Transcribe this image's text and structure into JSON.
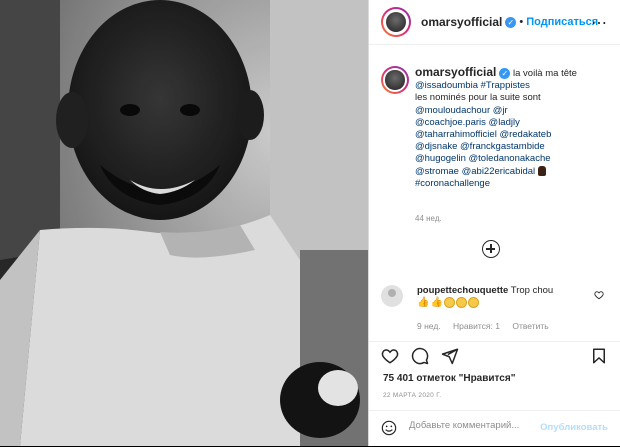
{
  "header": {
    "username": "omarsyofficial",
    "separator": "•",
    "follow_label": "Подписаться",
    "more_icon": "⋯"
  },
  "caption": {
    "username": "omarsyofficial",
    "line1": "la voilà ma tête",
    "line2_a": "@issadoumbia",
    "line2_b": "#Trappistes",
    "line3": "les nominés pour la suite sont",
    "tags": [
      "@mouloudachour",
      "@jr",
      "@coachjoe.paris",
      "@ladjly",
      "@taharrahimofficiel",
      "@redakateb",
      "@djsnake",
      "@franckgastambide",
      "@hugogelin",
      "@toledanonakache",
      "@stromae",
      "@abi22ericabidal"
    ],
    "hashtag": "#coronachallenge",
    "time": "44 нед."
  },
  "comment": {
    "username": "poupettechouquette",
    "text": "Trop chou",
    "time": "9 нед.",
    "likes": "Нравится: 1",
    "reply": "Ответить"
  },
  "likes_text": "75 401 отметок \"Нравится\"",
  "date": "22 МАРТА 2020 Г.",
  "add_comment": {
    "placeholder": "Добавьте комментарий...",
    "publish": "Опубликовать"
  },
  "colors": {
    "accent": "#0095f6",
    "verified": "#3897f0",
    "text": "#262626",
    "muted": "#8e8e8e"
  }
}
